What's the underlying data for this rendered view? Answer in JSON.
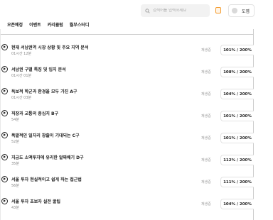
{
  "header": {
    "search": {
      "placeholder": "검색어를 입력하세요",
      "value": ""
    },
    "notification_icon": "notification-icon",
    "user": {
      "name": "도엽",
      "avatar_icon": "avatar-icon"
    }
  },
  "nav": {
    "items": [
      {
        "label": "오픈예정"
      },
      {
        "label": "이벤트"
      },
      {
        "label": "커리큘럼"
      },
      {
        "label": "월부스터디"
      }
    ]
  },
  "lectures": [
    {
      "title": "현재 서남권역 시장 상황 및 주요 지역 분석",
      "duration": "01시간 12분",
      "status": "재생중",
      "progress": "101% / 200%"
    },
    {
      "title": "서남권 구별 특징 및 입지 분석",
      "duration": "01시간 01분",
      "status": "재생중",
      "progress": "108% / 200%"
    },
    {
      "title": "독보적 학군과 환경을 모두 가진 A구",
      "duration": "01시간 03분",
      "status": "재생중",
      "progress": "104% / 200%"
    },
    {
      "title": "직장과 교통의 중심지 B구",
      "duration": "54분",
      "status": "재생중",
      "progress": "101% / 200%"
    },
    {
      "title": "폭발적인 일자리 창출이 기대되는 C구",
      "duration": "52분",
      "status": "재생중",
      "progress": "101% / 200%"
    },
    {
      "title": "지금도 소액투자에 유리한 알짜배기 D구",
      "duration": "35분",
      "status": "재생중",
      "progress": "112% / 200%"
    },
    {
      "title": "서울 투자 현실적이고 쉽게 하는 접근법",
      "duration": "56분",
      "status": "재생중",
      "progress": "111% / 200%"
    },
    {
      "title": "서울 투자 초보자 실전 꿀팁",
      "duration": "43분",
      "status": "재생중",
      "progress": "104% / 200%"
    }
  ],
  "colors": {
    "accent": "#f39a2b",
    "text": "#222222",
    "muted": "#888888",
    "border": "#e3e3e3"
  }
}
